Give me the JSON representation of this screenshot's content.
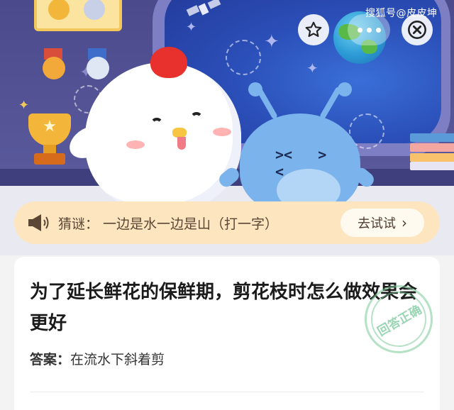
{
  "watermark": "搜狐号@皮皮坤",
  "icons": {
    "favorite": "star-outline-icon",
    "more": "more-dots-icon",
    "close": "close-circle-icon",
    "speaker": "megaphone-icon",
    "chevron": "chevron-right-icon"
  },
  "riddle": {
    "prefix": "猜谜：",
    "text": "一边是水一边是山（打一字）",
    "button_label": "去试试",
    "chevron": "›"
  },
  "question": {
    "title": "为了延长鲜花的保鲜期，剪花枝时怎么做效果会更好",
    "answer_label": "答案：",
    "answer_text": "在流水下斜着剪",
    "stamp_text": "回答正确"
  },
  "colors": {
    "hero_background": "#4a4a8c",
    "riddle_bar": "#fde6bf",
    "stamp": "#6ec391"
  }
}
